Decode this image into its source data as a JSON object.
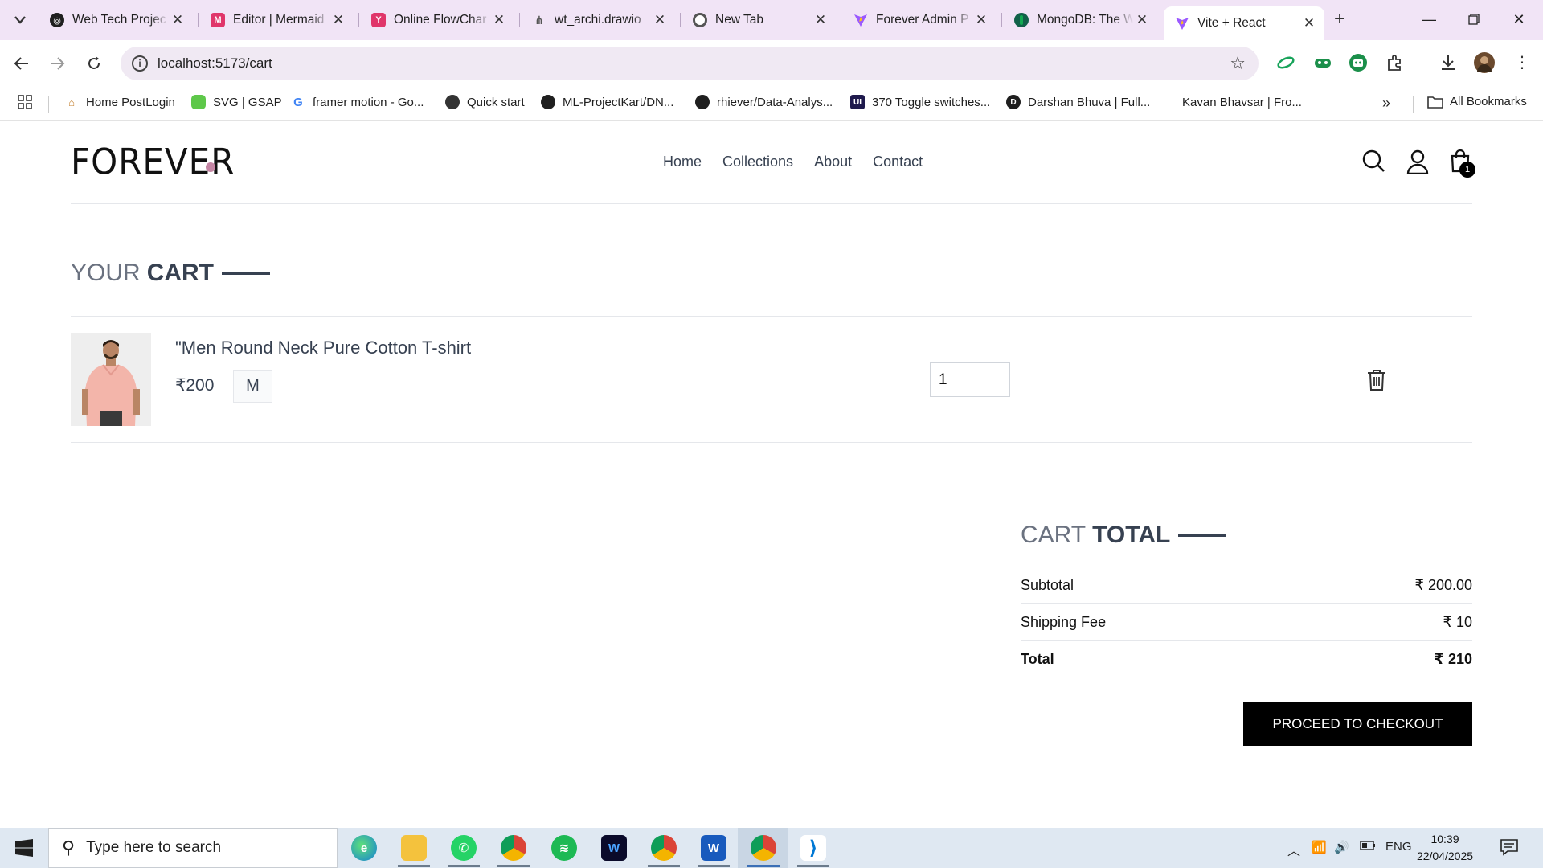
{
  "browser": {
    "tabs": [
      {
        "title": "Web Tech Projec",
        "icon": "ring-icon",
        "color": "#1f1f1f"
      },
      {
        "title": "Editor | Mermaid",
        "icon": "mermaid-icon",
        "color": "#e0356a"
      },
      {
        "title": "Online FlowChar",
        "icon": "flowchart-icon",
        "color": "#e0356a"
      },
      {
        "title": "wt_archi.drawio",
        "icon": "drawio-icon",
        "color": "#555555"
      },
      {
        "title": "New Tab",
        "icon": "chrome-icon",
        "color": "#555555"
      },
      {
        "title": "Forever Admin P",
        "icon": "vite-icon",
        "color": "#9b59ff"
      },
      {
        "title": "MongoDB: The W",
        "icon": "mongodb-leaf-icon",
        "color": "#116149"
      },
      {
        "title": "Vite + React",
        "icon": "vite-icon",
        "color": "#9b59ff",
        "active": true
      }
    ],
    "url": "localhost:5173/cart",
    "bookmarks": [
      {
        "label": "Home PostLogin",
        "icon": "postlogin-icon"
      },
      {
        "label": "SVG | GSAP",
        "icon": "gsap-icon"
      },
      {
        "label": "framer motion - Go...",
        "icon": "google-icon"
      },
      {
        "label": "Quick start",
        "icon": "globe-icon"
      },
      {
        "label": "ML-ProjectKart/DN...",
        "icon": "github-icon"
      },
      {
        "label": "rhiever/Data-Analys...",
        "icon": "github-icon"
      },
      {
        "label": "370 Toggle switches...",
        "icon": "uiverse-icon"
      },
      {
        "label": "Darshan Bhuva | Full...",
        "icon": "darshan-icon"
      },
      {
        "label": "Kavan Bhavsar | Fro...",
        "icon": "blank-icon"
      }
    ],
    "all_bookmarks": "All Bookmarks"
  },
  "site": {
    "logo": "FOREVER",
    "nav": [
      "Home",
      "Collections",
      "About",
      "Contact"
    ],
    "cart_count": "1"
  },
  "cart": {
    "title_light": "YOUR",
    "title_bold": "CART",
    "item": {
      "name": "\"Men Round Neck Pure Cotton T-shirt",
      "price": "₹200",
      "size": "M",
      "quantity": "1"
    }
  },
  "totals": {
    "title_light": "CART",
    "title_bold": "TOTAL",
    "subtotal_label": "Subtotal",
    "subtotal_value": "₹ 200.00",
    "shipping_label": "Shipping Fee",
    "shipping_value": "₹ 10",
    "total_label": "Total",
    "total_value": "₹ 210",
    "checkout_label": "PROCEED TO CHECKOUT"
  },
  "taskbar": {
    "search_placeholder": "Type here to search",
    "apps": [
      "edge-icon",
      "file-explorer-icon",
      "whatsapp-icon",
      "chrome-icon",
      "spotify-icon",
      "webex-icon",
      "chrome-profile-icon",
      "word-icon",
      "chrome-active-icon",
      "vscode-icon"
    ],
    "lang": "ENG",
    "time": "10:39",
    "date": "22/04/2025"
  }
}
